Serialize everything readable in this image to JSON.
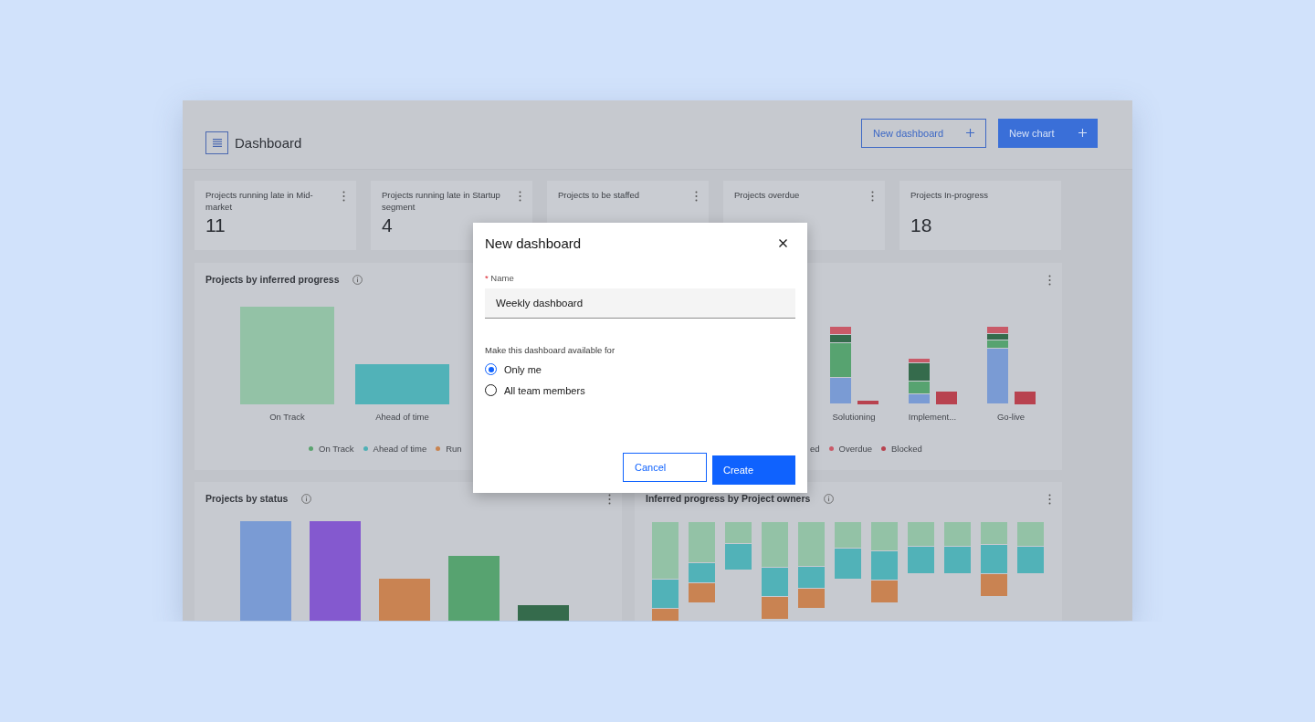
{
  "header": {
    "title": "Dashboard",
    "buttons": [
      {
        "label": "New dashboard",
        "kind": "secondary"
      },
      {
        "label": "New chart",
        "kind": "primary"
      }
    ]
  },
  "kpi_cards": [
    {
      "title": "Projects running late in Mid-market",
      "value": "11",
      "menu": true
    },
    {
      "title": "Projects running late in Startup segment",
      "value": "4",
      "menu": true
    },
    {
      "title": "Projects to be staffed",
      "menu": true
    },
    {
      "title": "Projects overdue",
      "menu": true
    },
    {
      "title": "Projects In-progress",
      "value": "18",
      "menu": false
    }
  ],
  "panels": [
    {
      "title": "Projects by inferred progress",
      "info": true,
      "menu": false,
      "chart": {
        "kind": "simple",
        "categories": [
          "On Track",
          "Ahead of time"
        ]
      },
      "legend": [
        {
          "label": "On Track",
          "color": "#5aa36f"
        },
        {
          "label": "Ahead of time",
          "color": "#4fb0b6"
        },
        {
          "label": "Run",
          "color": "#c9834f"
        }
      ]
    },
    {
      "info": false,
      "menu": true,
      "chart": {
        "kind": "grouped",
        "categories": [
          "Solutioning",
          "Implement...",
          "Go-live"
        ]
      },
      "legend": [
        {
          "label": "ed"
        },
        {
          "label": "Overdue",
          "color": "#c95a68"
        },
        {
          "label": "Blocked",
          "color": "#b8424f"
        }
      ]
    },
    {
      "title": "Projects by status",
      "info": true,
      "menu": true,
      "chart": {
        "kind": "status"
      }
    },
    {
      "title": "Inferred progress by Project owners",
      "info": true,
      "menu": true,
      "chart": {
        "kind": "owners"
      }
    }
  ],
  "modal": {
    "title": "New dashboard",
    "field": {
      "required_mark": "*",
      "label": "Name",
      "value": "Weekly dashboard"
    },
    "group_label": "Make this dashboard available for",
    "options": [
      {
        "label": "Only me",
        "selected": true
      },
      {
        "label": "All team members",
        "selected": false
      }
    ],
    "buttons": [
      {
        "label": "Cancel",
        "kind": "secondary"
      },
      {
        "label": "Create",
        "kind": "primary"
      }
    ]
  }
}
